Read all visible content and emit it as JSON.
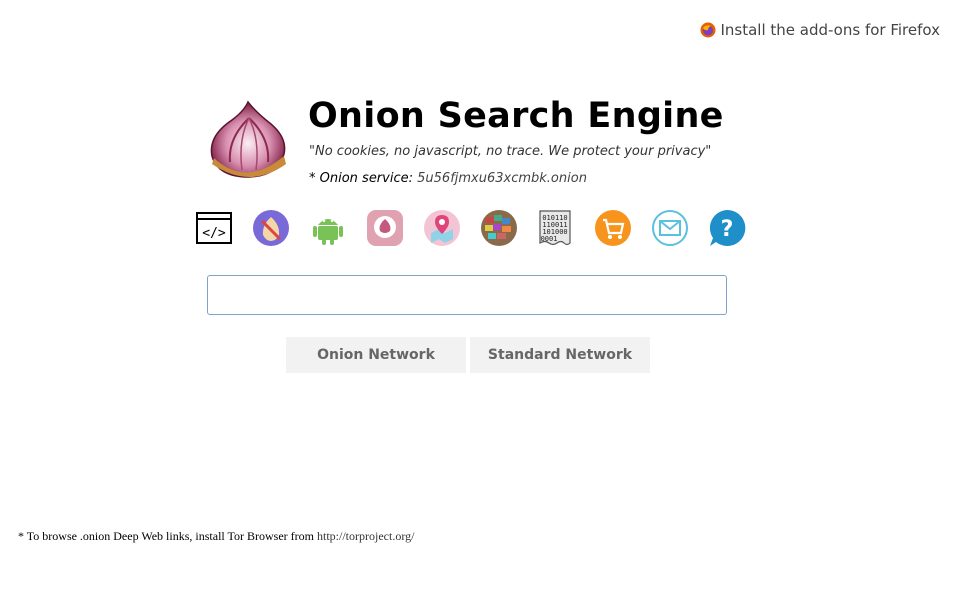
{
  "topbar": {
    "firefox_link_label": "Install the add-ons for Firefox"
  },
  "header": {
    "title": "Onion Search Engine",
    "tagline": "\"No cookies, no javascript, no trace. We protect your privacy\"",
    "onion_service_label": "* Onion service:",
    "onion_service_address": "5u56fjmxu63xcmbk.onion"
  },
  "icons": [
    {
      "name": "code-icon"
    },
    {
      "name": "onion-character-icon"
    },
    {
      "name": "android-icon"
    },
    {
      "name": "onion-chat-icon"
    },
    {
      "name": "map-pin-icon"
    },
    {
      "name": "globe-mosaic-icon"
    },
    {
      "name": "binary-icon"
    },
    {
      "name": "shopping-cart-icon"
    },
    {
      "name": "mail-icon"
    },
    {
      "name": "help-icon"
    }
  ],
  "search": {
    "value": "",
    "placeholder": ""
  },
  "buttons": {
    "onion_network": "Onion Network",
    "standard_network": "Standard Network"
  },
  "footer": {
    "text": "* To browse .onion Deep Web links, install Tor Browser from",
    "link": "http://torproject.org/"
  },
  "colors": {
    "search_border": "#7fa3c9",
    "button_bg": "#f2f2f2",
    "button_text": "#666666"
  }
}
